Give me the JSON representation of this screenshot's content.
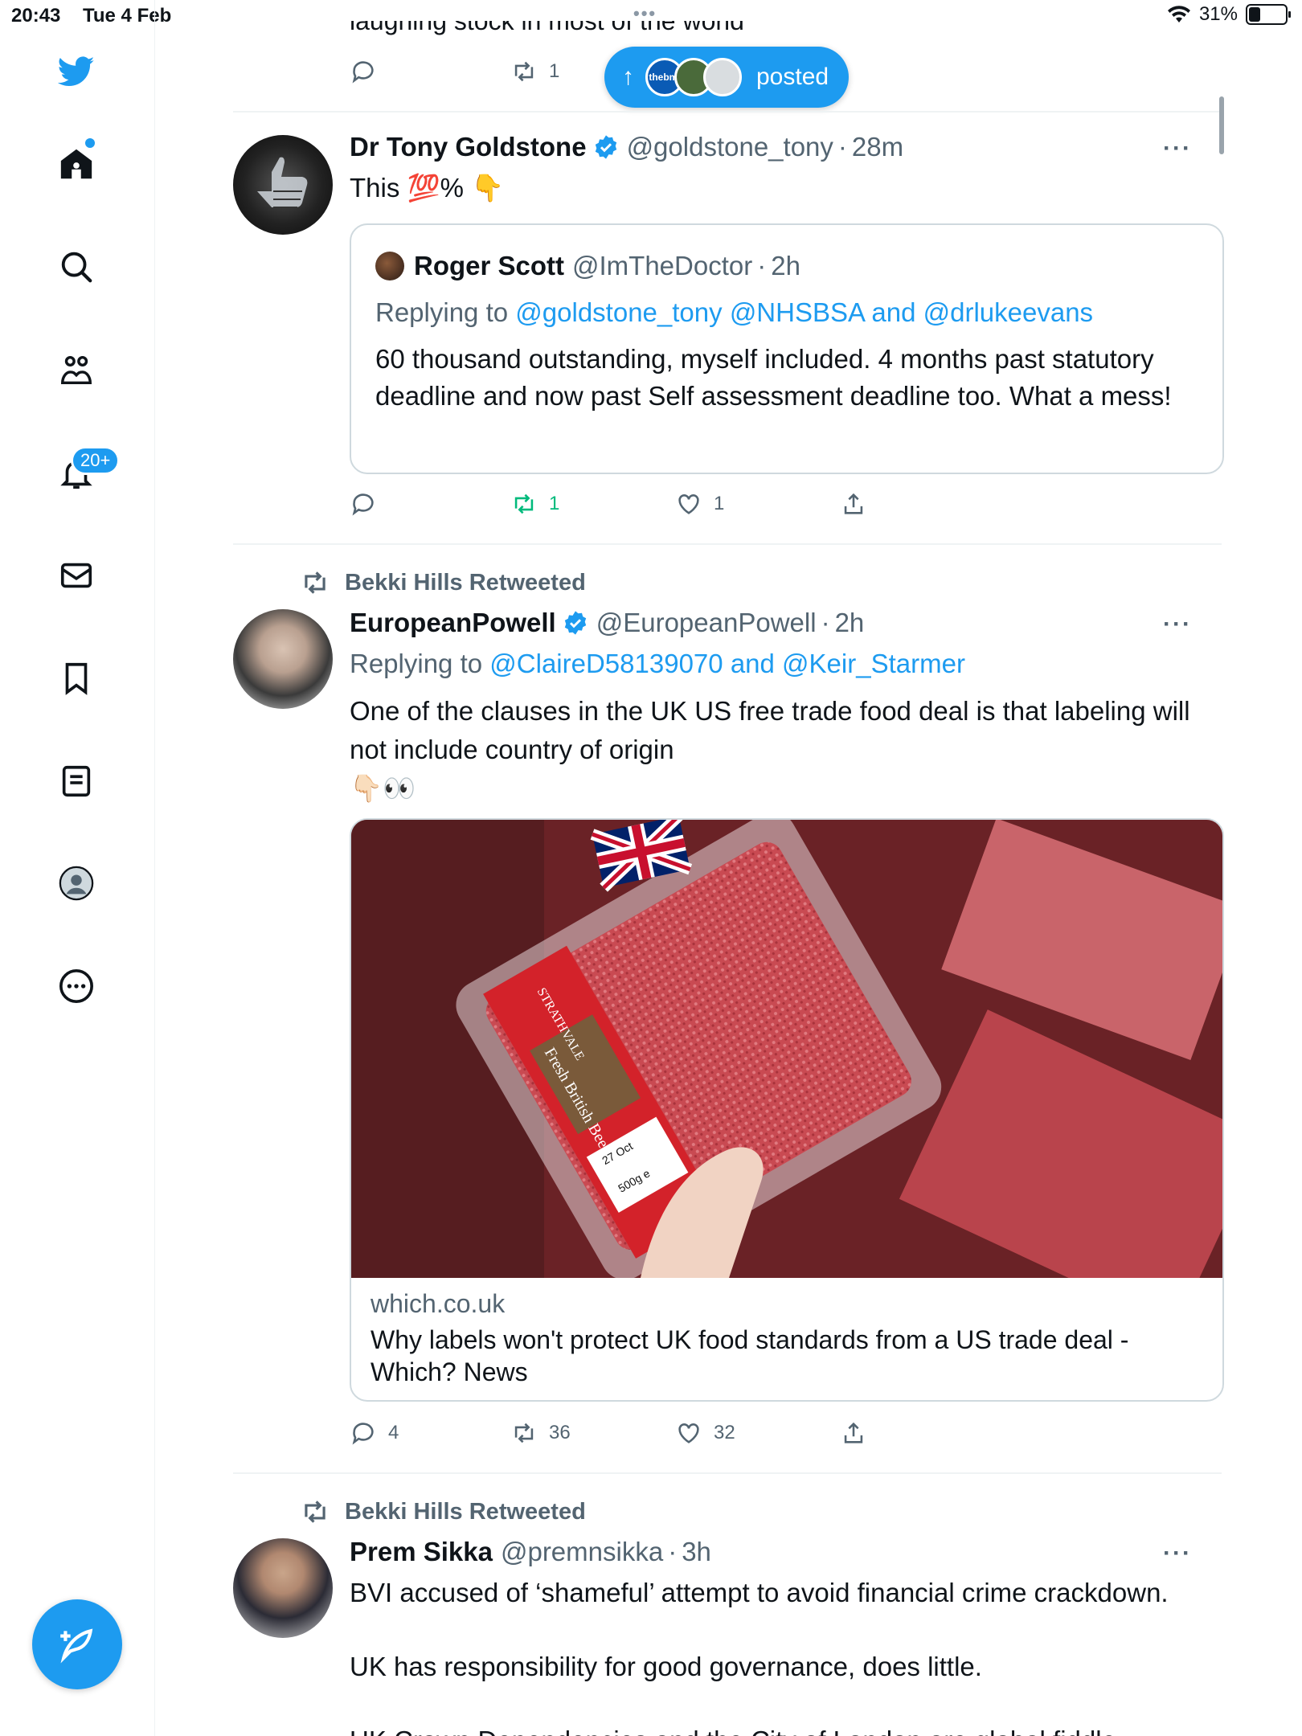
{
  "status_bar": {
    "time": "20:43",
    "date": "Tue 4 Feb",
    "battery_percent": "31%",
    "battery_level": 0.31
  },
  "sidebar": {
    "items": [
      {
        "name": "home",
        "icon": "home-icon"
      },
      {
        "name": "search",
        "icon": "search-icon"
      },
      {
        "name": "communities",
        "icon": "communities-icon"
      },
      {
        "name": "notifications",
        "icon": "bell-icon",
        "badge": "20+"
      },
      {
        "name": "messages",
        "icon": "mail-icon"
      },
      {
        "name": "bookmarks",
        "icon": "bookmark-icon"
      },
      {
        "name": "lists",
        "icon": "lists-icon"
      },
      {
        "name": "profile",
        "icon": "profile-icon"
      },
      {
        "name": "more",
        "icon": "more-circle-icon"
      }
    ],
    "compose_icon": "compose-icon"
  },
  "top_fragment": {
    "text": "laughing stock in most of the world",
    "retweet_count": "1"
  },
  "posted_pill": {
    "label": "posted",
    "avatar_1_label": "thebmj"
  },
  "tweets": [
    {
      "name": "Dr Tony Goldstone",
      "handle": "@goldstone_tony",
      "time": "28m",
      "text": "This 💯% 👇",
      "quote": {
        "name": "Roger Scott",
        "handle": "@ImTheDoctor",
        "time": "2h",
        "replying_prefix": "Replying to",
        "replying_1": "@goldstone_tony",
        "replying_2": "@NHSBSA",
        "replying_and": "and",
        "replying_3": "@drlukeevans",
        "text": "60 thousand outstanding, myself included. 4 months past statutory deadline and now past Self assessment deadline too.  What a mess!"
      },
      "replies": "",
      "retweets": "1",
      "likes": "1"
    },
    {
      "retweeted_by": "Bekki Hills Retweeted",
      "name": "EuropeanPowell",
      "handle": "@EuropeanPowell",
      "time": "2h",
      "replying_prefix": "Replying to",
      "replying_1": "@ClaireD58139070",
      "replying_and": "and",
      "replying_2": "@Keir_Starmer",
      "text_line1": "One of the clauses in the UK US free trade food deal is that labeling will",
      "text_line2": "not include country of origin",
      "text_line3": "👇🏻👀",
      "card": {
        "domain": "which.co.uk",
        "title": "Why labels won't protect UK food standards from a US trade deal - Which? News",
        "image_brand": "STRATHVALE",
        "image_product": "Fresh British Beef Mince",
        "image_date": "27 Oct",
        "image_weight": "500g e"
      },
      "replies": "4",
      "retweets": "36",
      "likes": "32"
    },
    {
      "retweeted_by": "Bekki Hills Retweeted",
      "name": "Prem Sikka",
      "handle": "@premnsikka",
      "time": "3h",
      "text_line1": "BVI accused of ‘shameful’ attempt to avoid financial crime crackdown.",
      "text_line2": "UK has responsibility for good governance, does little.",
      "text_line3": "UK Crown Dependencies and the City of London are global fiddle"
    }
  ],
  "colors": {
    "accent": "#1d9bf0",
    "retweet_green": "#00ba7c",
    "text": "#0f1419",
    "muted": "#536471"
  }
}
